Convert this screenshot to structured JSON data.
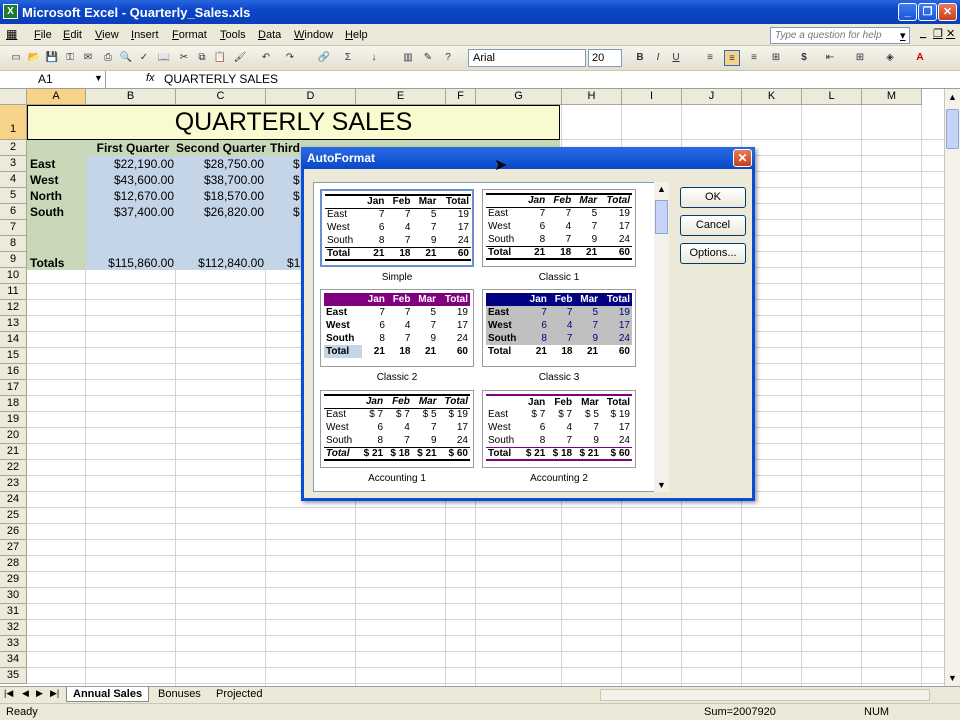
{
  "window": {
    "title": "Microsoft Excel - Quarterly_Sales.xls",
    "logo": "X"
  },
  "menu": [
    "File",
    "Edit",
    "View",
    "Insert",
    "Format",
    "Tools",
    "Data",
    "Window",
    "Help"
  ],
  "help_placeholder": "Type a question for help",
  "toolbar": {
    "font": "Arial",
    "size": "20"
  },
  "formula": {
    "cell": "A1",
    "fx": "fx",
    "value": "QUARTERLY SALES"
  },
  "columns": [
    "A",
    "B",
    "C",
    "D",
    "E",
    "F",
    "G",
    "H",
    "I",
    "J",
    "K",
    "L",
    "M"
  ],
  "sheet": {
    "title": "QUARTERLY SALES",
    "headers": [
      "First Quarter",
      "Second Quarter",
      "Third"
    ],
    "rows": [
      {
        "label": "East",
        "b": "$22,190.00",
        "c": "$28,750.00",
        "d": "$"
      },
      {
        "label": "West",
        "b": "$43,600.00",
        "c": "$38,700.00",
        "d": "$"
      },
      {
        "label": "North",
        "b": "$12,670.00",
        "c": "$18,570.00",
        "d": "$"
      },
      {
        "label": "South",
        "b": "$37,400.00",
        "c": "$26,820.00",
        "d": "$"
      }
    ],
    "totals": {
      "label": "Totals",
      "b": "$115,860.00",
      "c": "$112,840.00",
      "d": "$1"
    }
  },
  "dialog": {
    "title": "AutoFormat",
    "buttons": {
      "ok": "OK",
      "cancel": "Cancel",
      "options": "Options..."
    },
    "formats": [
      {
        "name": "Simple",
        "header": [
          "",
          "Jan",
          "Feb",
          "Mar",
          "Total"
        ],
        "rows": [
          [
            "East",
            "7",
            "7",
            "5",
            "19"
          ],
          [
            "West",
            "6",
            "4",
            "7",
            "17"
          ],
          [
            "South",
            "8",
            "7",
            "9",
            "24"
          ],
          [
            "Total",
            "21",
            "18",
            "21",
            "60"
          ]
        ]
      },
      {
        "name": "Classic 1",
        "header": [
          "",
          "Jan",
          "Feb",
          "Mar",
          "Total"
        ],
        "rows": [
          [
            "East",
            "7",
            "7",
            "5",
            "19"
          ],
          [
            "West",
            "6",
            "4",
            "7",
            "17"
          ],
          [
            "South",
            "8",
            "7",
            "9",
            "24"
          ],
          [
            "Total",
            "21",
            "18",
            "21",
            "60"
          ]
        ]
      },
      {
        "name": "Classic 2",
        "header": [
          "",
          "Jan",
          "Feb",
          "Mar",
          "Total"
        ],
        "rows": [
          [
            "East",
            "7",
            "7",
            "5",
            "19"
          ],
          [
            "West",
            "6",
            "4",
            "7",
            "17"
          ],
          [
            "South",
            "8",
            "7",
            "9",
            "24"
          ],
          [
            "Total",
            "21",
            "18",
            "21",
            "60"
          ]
        ]
      },
      {
        "name": "Classic 3",
        "header": [
          "",
          "Jan",
          "Feb",
          "Mar",
          "Total"
        ],
        "rows": [
          [
            "East",
            "7",
            "7",
            "5",
            "19"
          ],
          [
            "West",
            "6",
            "4",
            "7",
            "17"
          ],
          [
            "South",
            "8",
            "7",
            "9",
            "24"
          ],
          [
            "Total",
            "21",
            "18",
            "21",
            "60"
          ]
        ]
      },
      {
        "name": "Accounting 1",
        "header": [
          "",
          "Jan",
          "Feb",
          "Mar",
          "Total"
        ],
        "rows": [
          [
            "East",
            "$ 7",
            "$ 7",
            "$ 5",
            "$ 19"
          ],
          [
            "West",
            "6",
            "4",
            "7",
            "17"
          ],
          [
            "South",
            "8",
            "7",
            "9",
            "24"
          ],
          [
            "Total",
            "$ 21",
            "$ 18",
            "$ 21",
            "$ 60"
          ]
        ]
      },
      {
        "name": "Accounting 2",
        "header": [
          "",
          "Jan",
          "Feb",
          "Mar",
          "Total"
        ],
        "rows": [
          [
            "East",
            "$ 7",
            "$ 7",
            "$ 5",
            "$ 19"
          ],
          [
            "West",
            "6",
            "4",
            "7",
            "17"
          ],
          [
            "South",
            "8",
            "7",
            "9",
            "24"
          ],
          [
            "Total",
            "$ 21",
            "$ 18",
            "$ 21",
            "$ 60"
          ]
        ]
      }
    ]
  },
  "tabs": [
    "Annual Sales",
    "Bonuses",
    "Projected"
  ],
  "status": {
    "left": "Ready",
    "sum": "Sum=2007920",
    "num": "NUM"
  },
  "colors": {
    "header_fill": "#fafad0",
    "data_fill": "#c5d5e8",
    "label_fill": "#c8d8b8",
    "classic2_purple": "#800080",
    "classic3_navy": "#000080",
    "classic3_gray": "#c0c0c0"
  }
}
